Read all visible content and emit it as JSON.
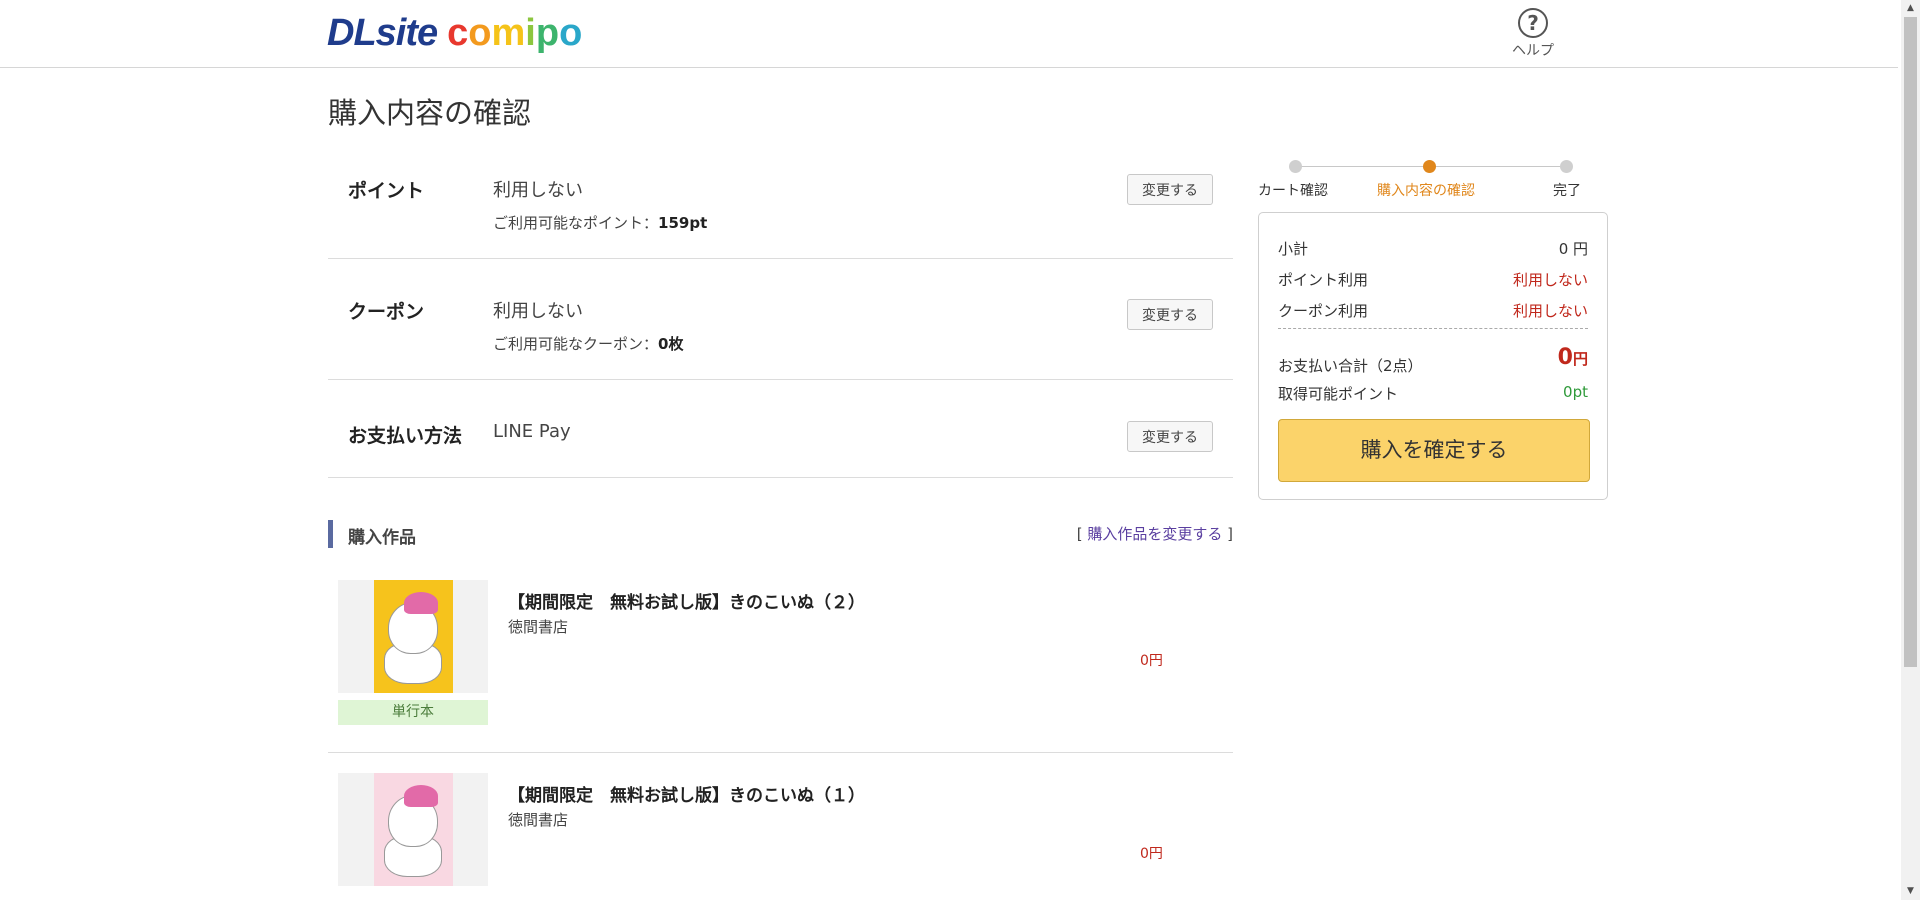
{
  "header": {
    "logo_dl": "DLsite",
    "logo_comipo": [
      "c",
      "o",
      "m",
      "i",
      "p",
      "o"
    ],
    "logo_colors": [
      "#e8382e",
      "#f39a1e",
      "#f5c319",
      "#8cc63f",
      "#3db46d",
      "#2aa7c9"
    ],
    "help_label": "ヘルプ"
  },
  "page": {
    "title": "購入内容の確認"
  },
  "settings": {
    "point": {
      "label": "ポイント",
      "value": "利用しない",
      "sub_label": "ご利用可能なポイント：",
      "sub_value": "159pt",
      "button": "変更する"
    },
    "coupon": {
      "label": "クーポン",
      "value": "利用しない",
      "sub_label": "ご利用可能なクーポン：",
      "sub_value": "0枚",
      "button": "変更する"
    },
    "payment": {
      "label": "お支払い方法",
      "value": "LINE Pay",
      "button": "変更する"
    }
  },
  "items_section": {
    "title": "購入作品",
    "link_open": "[ ",
    "link_text": "購入作品を変更する",
    "link_close": " ]"
  },
  "items": [
    {
      "title": "【期間限定　無料お試し版】きのこいぬ（２）",
      "publisher": "徳間書店",
      "price": "0円",
      "badge": "単行本"
    },
    {
      "title": "【期間限定　無料お試し版】きのこいぬ（１）",
      "publisher": "徳間書店",
      "price": "0円"
    }
  ],
  "steps": [
    {
      "label": "カート確認",
      "active": false
    },
    {
      "label": "購入内容の確認",
      "active": true
    },
    {
      "label": "完了",
      "active": false
    }
  ],
  "summary": {
    "subtotal_label": "小計",
    "subtotal_value": "0 円",
    "point_label": "ポイント利用",
    "point_value": "利用しない",
    "coupon_label": "クーポン利用",
    "coupon_value": "利用しない",
    "total_label": "お支払い合計（2点）",
    "total_value": "0",
    "total_unit": "円",
    "earn_label": "取得可能ポイント",
    "earn_value": "0pt",
    "confirm_button": "購入を確定する"
  },
  "colors": {
    "accent_orange": "#e0871c",
    "price_red": "#c0281c",
    "earn_green": "#2f9a3a",
    "confirm_yellow": "#fbd36a"
  }
}
